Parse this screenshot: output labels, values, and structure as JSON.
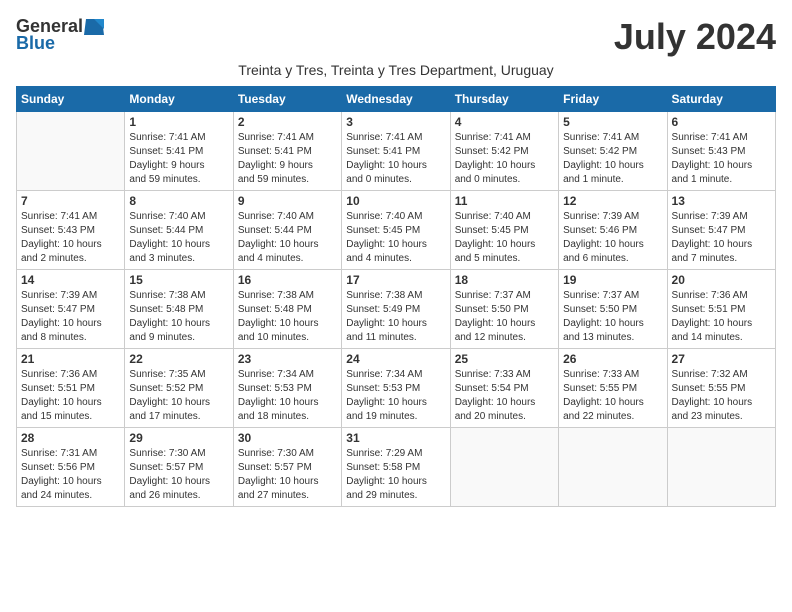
{
  "logo": {
    "general": "General",
    "blue": "Blue"
  },
  "title": "July 2024",
  "subtitle": "Treinta y Tres, Treinta y Tres Department, Uruguay",
  "headers": [
    "Sunday",
    "Monday",
    "Tuesday",
    "Wednesday",
    "Thursday",
    "Friday",
    "Saturday"
  ],
  "weeks": [
    [
      {
        "day": "",
        "info": ""
      },
      {
        "day": "1",
        "info": "Sunrise: 7:41 AM\nSunset: 5:41 PM\nDaylight: 9 hours\nand 59 minutes."
      },
      {
        "day": "2",
        "info": "Sunrise: 7:41 AM\nSunset: 5:41 PM\nDaylight: 9 hours\nand 59 minutes."
      },
      {
        "day": "3",
        "info": "Sunrise: 7:41 AM\nSunset: 5:41 PM\nDaylight: 10 hours\nand 0 minutes."
      },
      {
        "day": "4",
        "info": "Sunrise: 7:41 AM\nSunset: 5:42 PM\nDaylight: 10 hours\nand 0 minutes."
      },
      {
        "day": "5",
        "info": "Sunrise: 7:41 AM\nSunset: 5:42 PM\nDaylight: 10 hours\nand 1 minute."
      },
      {
        "day": "6",
        "info": "Sunrise: 7:41 AM\nSunset: 5:43 PM\nDaylight: 10 hours\nand 1 minute."
      }
    ],
    [
      {
        "day": "7",
        "info": "Sunrise: 7:41 AM\nSunset: 5:43 PM\nDaylight: 10 hours\nand 2 minutes."
      },
      {
        "day": "8",
        "info": "Sunrise: 7:40 AM\nSunset: 5:44 PM\nDaylight: 10 hours\nand 3 minutes."
      },
      {
        "day": "9",
        "info": "Sunrise: 7:40 AM\nSunset: 5:44 PM\nDaylight: 10 hours\nand 4 minutes."
      },
      {
        "day": "10",
        "info": "Sunrise: 7:40 AM\nSunset: 5:45 PM\nDaylight: 10 hours\nand 4 minutes."
      },
      {
        "day": "11",
        "info": "Sunrise: 7:40 AM\nSunset: 5:45 PM\nDaylight: 10 hours\nand 5 minutes."
      },
      {
        "day": "12",
        "info": "Sunrise: 7:39 AM\nSunset: 5:46 PM\nDaylight: 10 hours\nand 6 minutes."
      },
      {
        "day": "13",
        "info": "Sunrise: 7:39 AM\nSunset: 5:47 PM\nDaylight: 10 hours\nand 7 minutes."
      }
    ],
    [
      {
        "day": "14",
        "info": "Sunrise: 7:39 AM\nSunset: 5:47 PM\nDaylight: 10 hours\nand 8 minutes."
      },
      {
        "day": "15",
        "info": "Sunrise: 7:38 AM\nSunset: 5:48 PM\nDaylight: 10 hours\nand 9 minutes."
      },
      {
        "day": "16",
        "info": "Sunrise: 7:38 AM\nSunset: 5:48 PM\nDaylight: 10 hours\nand 10 minutes."
      },
      {
        "day": "17",
        "info": "Sunrise: 7:38 AM\nSunset: 5:49 PM\nDaylight: 10 hours\nand 11 minutes."
      },
      {
        "day": "18",
        "info": "Sunrise: 7:37 AM\nSunset: 5:50 PM\nDaylight: 10 hours\nand 12 minutes."
      },
      {
        "day": "19",
        "info": "Sunrise: 7:37 AM\nSunset: 5:50 PM\nDaylight: 10 hours\nand 13 minutes."
      },
      {
        "day": "20",
        "info": "Sunrise: 7:36 AM\nSunset: 5:51 PM\nDaylight: 10 hours\nand 14 minutes."
      }
    ],
    [
      {
        "day": "21",
        "info": "Sunrise: 7:36 AM\nSunset: 5:51 PM\nDaylight: 10 hours\nand 15 minutes."
      },
      {
        "day": "22",
        "info": "Sunrise: 7:35 AM\nSunset: 5:52 PM\nDaylight: 10 hours\nand 17 minutes."
      },
      {
        "day": "23",
        "info": "Sunrise: 7:34 AM\nSunset: 5:53 PM\nDaylight: 10 hours\nand 18 minutes."
      },
      {
        "day": "24",
        "info": "Sunrise: 7:34 AM\nSunset: 5:53 PM\nDaylight: 10 hours\nand 19 minutes."
      },
      {
        "day": "25",
        "info": "Sunrise: 7:33 AM\nSunset: 5:54 PM\nDaylight: 10 hours\nand 20 minutes."
      },
      {
        "day": "26",
        "info": "Sunrise: 7:33 AM\nSunset: 5:55 PM\nDaylight: 10 hours\nand 22 minutes."
      },
      {
        "day": "27",
        "info": "Sunrise: 7:32 AM\nSunset: 5:55 PM\nDaylight: 10 hours\nand 23 minutes."
      }
    ],
    [
      {
        "day": "28",
        "info": "Sunrise: 7:31 AM\nSunset: 5:56 PM\nDaylight: 10 hours\nand 24 minutes."
      },
      {
        "day": "29",
        "info": "Sunrise: 7:30 AM\nSunset: 5:57 PM\nDaylight: 10 hours\nand 26 minutes."
      },
      {
        "day": "30",
        "info": "Sunrise: 7:30 AM\nSunset: 5:57 PM\nDaylight: 10 hours\nand 27 minutes."
      },
      {
        "day": "31",
        "info": "Sunrise: 7:29 AM\nSunset: 5:58 PM\nDaylight: 10 hours\nand 29 minutes."
      },
      {
        "day": "",
        "info": ""
      },
      {
        "day": "",
        "info": ""
      },
      {
        "day": "",
        "info": ""
      }
    ]
  ]
}
